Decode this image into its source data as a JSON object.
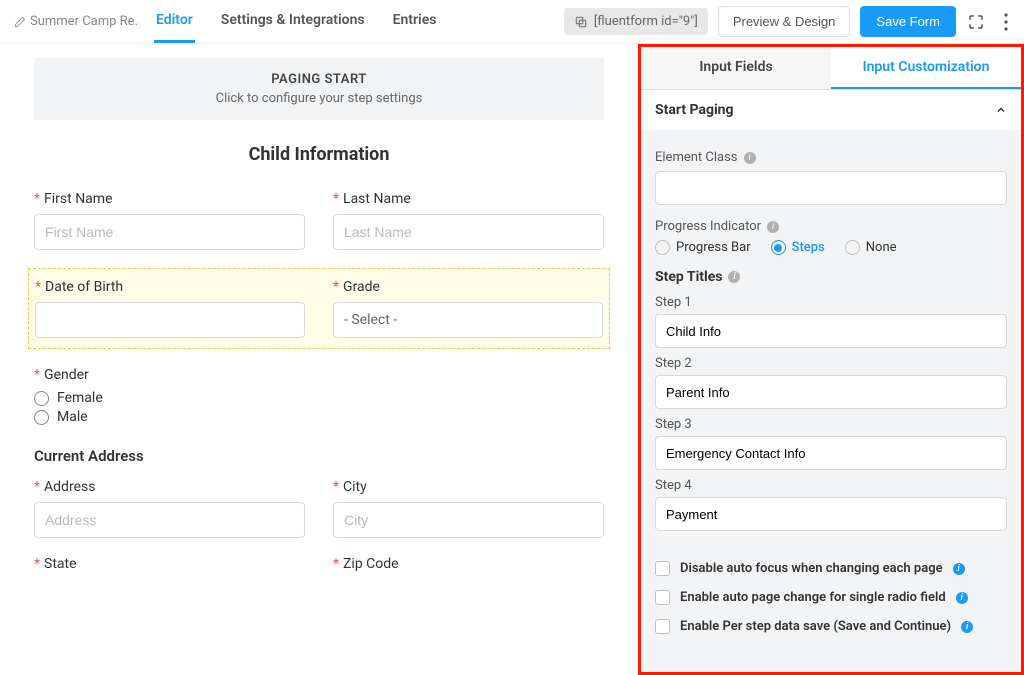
{
  "header": {
    "form_title": "Summer Camp Re...",
    "tabs": {
      "editor": "Editor",
      "settings": "Settings & Integrations",
      "entries": "Entries"
    },
    "shortcode": "[fluentform id=\"9\"]",
    "preview": "Preview & Design",
    "save": "Save Form"
  },
  "canvas": {
    "paging_title": "PAGING START",
    "paging_sub": "Click to configure your step settings",
    "section_title": "Child Information",
    "first_name": {
      "label": "First Name",
      "placeholder": "First Name"
    },
    "last_name": {
      "label": "Last Name",
      "placeholder": "Last Name"
    },
    "dob": {
      "label": "Date of Birth"
    },
    "grade": {
      "label": "Grade",
      "placeholder": "- Select -"
    },
    "gender": {
      "label": "Gender",
      "opts": {
        "female": "Female",
        "male": "Male"
      }
    },
    "address_section": "Current Address",
    "address": {
      "label": "Address",
      "placeholder": "Address"
    },
    "city": {
      "label": "City",
      "placeholder": "City"
    },
    "state": {
      "label": "State"
    },
    "zip": {
      "label": "Zip Code"
    }
  },
  "panel": {
    "tabs": {
      "input": "Input Fields",
      "custom": "Input Customization"
    },
    "accordion_title": "Start Paging",
    "element_class": "Element Class",
    "progress": {
      "label": "Progress Indicator",
      "opts": {
        "bar": "Progress Bar",
        "steps": "Steps",
        "none": "None"
      }
    },
    "step_titles": "Step Titles",
    "steps": [
      {
        "label": "Step 1",
        "value": "Child Info"
      },
      {
        "label": "Step 2",
        "value": "Parent Info"
      },
      {
        "label": "Step 3",
        "value": "Emergency Contact Info"
      },
      {
        "label": "Step 4",
        "value": "Payment"
      }
    ],
    "checks": {
      "autofocus": "Disable auto focus when changing each page",
      "autopage": "Enable auto page change for single radio field",
      "saveresume": "Enable Per step data save (Save and Continue)"
    }
  }
}
